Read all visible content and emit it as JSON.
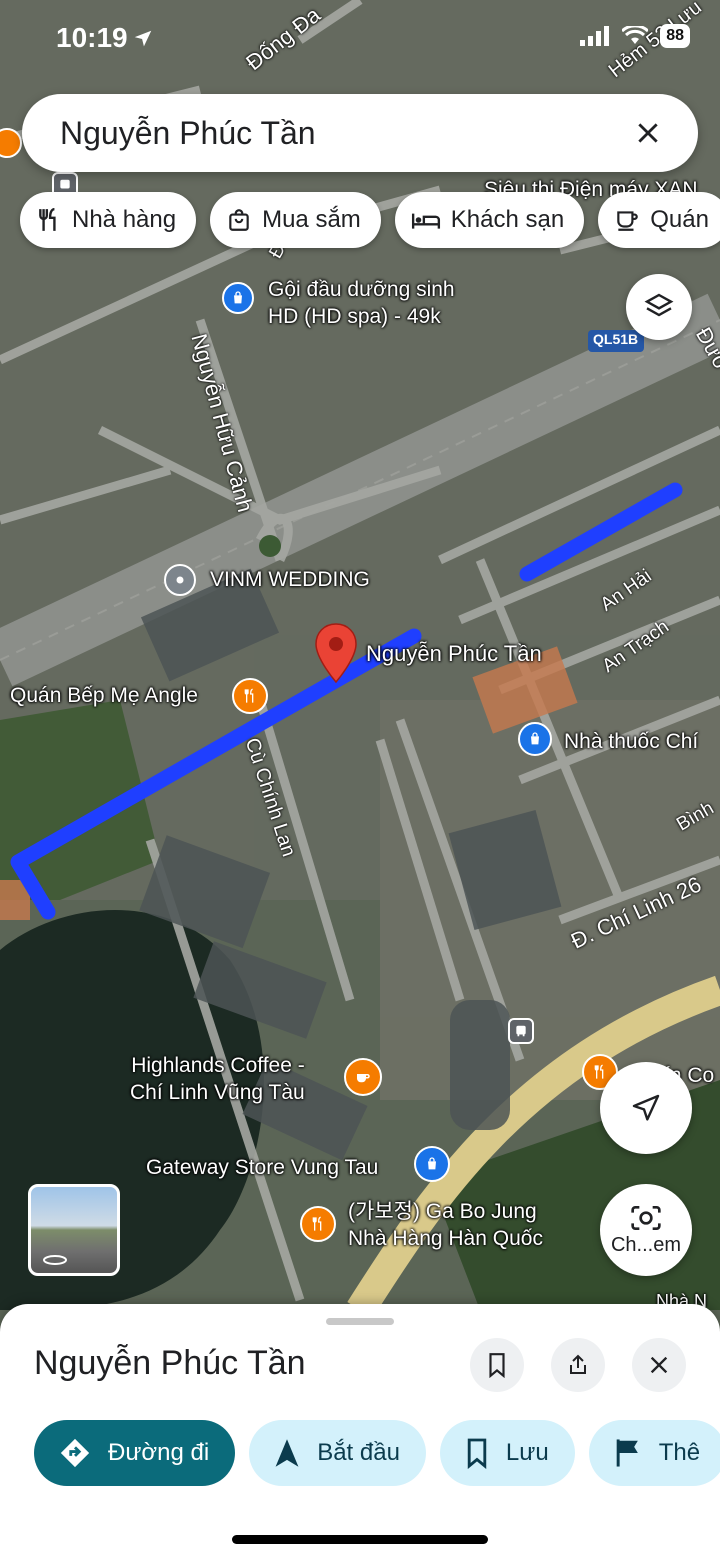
{
  "status_bar": {
    "time": "10:19",
    "battery": "88"
  },
  "search": {
    "query": "Nguyễn Phúc Tần"
  },
  "chips": [
    {
      "label": "Nhà hàng",
      "icon": "fork-knife-icon"
    },
    {
      "label": "Mua sắm",
      "icon": "shopping-bag-icon"
    },
    {
      "label": "Khách sạn",
      "icon": "bed-icon"
    },
    {
      "label": "Quán",
      "icon": "cup-icon"
    }
  ],
  "map": {
    "streets": {
      "dong_da": "Đống Đa",
      "hem": "Hẻm 53 Lưu",
      "nguyen_huu_canh": "Nguyễn Hữu Cảnh",
      "an_hai": "An Hải",
      "an_trach": "An Trạch",
      "cu_chinh_lan": "Cù Chính Lan",
      "chi_linh_26": "Đ. Chí Linh 26",
      "binh": "Bình",
      "duong": "Đườ",
      "d_short": "Đ.",
      "ql51b": "QL51B"
    },
    "places": {
      "sieu_thi": "Siêu thị Điện máy XAN",
      "goi_dau": "Gội đầu dưỡng sinh\nHD (HD spa) - 49k",
      "vinm": "VINM WEDDING",
      "selected": "Nguyễn Phúc Tần",
      "quan_bep": "Quán Bếp Mẹ Angle",
      "nha_thuoc": "Nhà thuốc Chí",
      "highlands": "Highlands Coffee -\nChí Linh Vũng Tàu",
      "gateway": "Gateway Store Vung Tau",
      "gabojung": "(가보정) Ga Bo Jung\nNhà Hàng Hàn Quốc",
      "van_co": "ín Co",
      "nha_n": "Nhà N"
    },
    "camera_label": "Ch...em"
  },
  "sheet": {
    "title": "Nguyễn Phúc Tần",
    "actions": [
      {
        "label": "Đường đi",
        "icon": "directions-icon"
      },
      {
        "label": "Bắt đầu",
        "icon": "navigation-arrow-icon"
      },
      {
        "label": "Lưu",
        "icon": "bookmark-icon"
      },
      {
        "label": "Thê",
        "icon": "flag-icon"
      }
    ]
  },
  "colors": {
    "accent": "#0b6b7b",
    "route": "#1f3fff",
    "pin": "#ea4335"
  }
}
